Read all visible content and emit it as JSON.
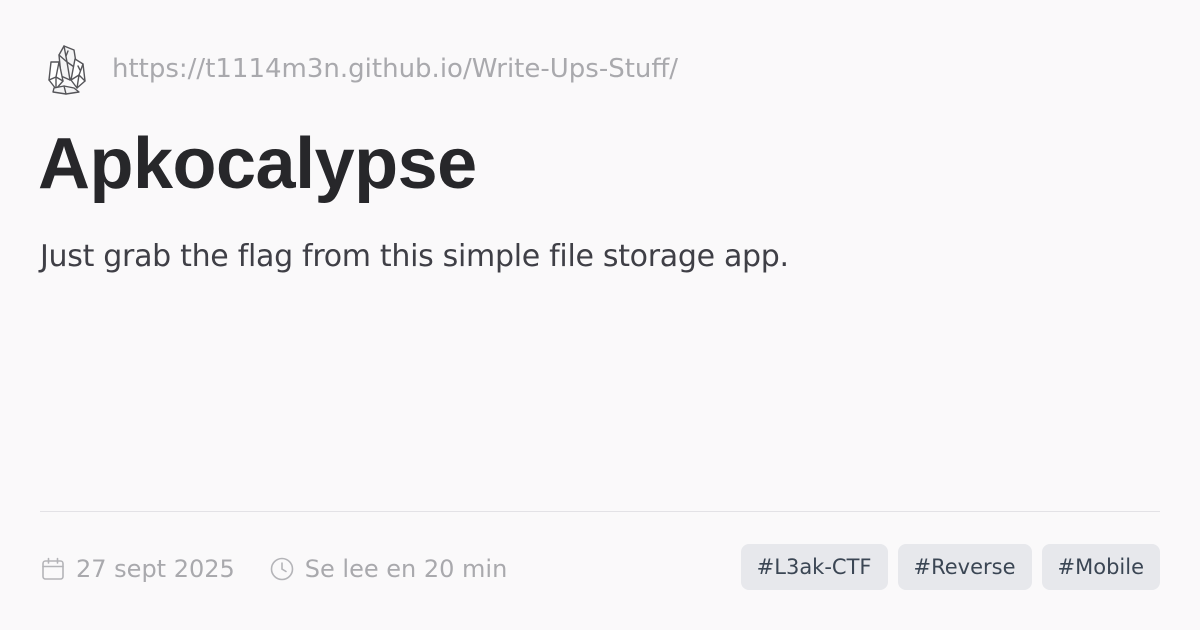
{
  "site": {
    "icon": "crystal-cluster-icon",
    "url": "https://t1114m3n.github.io/Write-Ups-Stuff/"
  },
  "post": {
    "title": "Apkocalypse",
    "description": "Just grab the flag from this simple file storage app."
  },
  "meta": {
    "date_icon": "calendar-icon",
    "date": "27 sept 2025",
    "reading_icon": "clock-icon",
    "reading_time": "Se lee en 20 min"
  },
  "tags": [
    {
      "label": "#L3ak-CTF"
    },
    {
      "label": "#Reverse"
    },
    {
      "label": "#Mobile"
    }
  ],
  "colors": {
    "background": "#faf9fa",
    "title": "#27272a",
    "description": "#3f3f46",
    "muted": "#a9a9ad",
    "tag_background": "#e7e8ec",
    "tag_text": "#3b4654",
    "divider": "#e3e2e6"
  }
}
